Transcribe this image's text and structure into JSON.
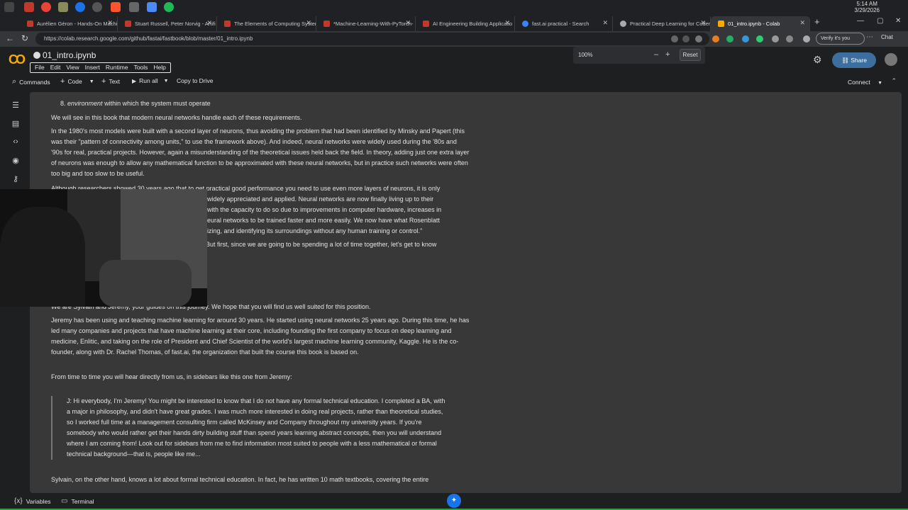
{
  "os": {
    "clock_time": "5:14 AM",
    "clock_date": "3/29/2026"
  },
  "tabs": [
    {
      "label": "Aurélien Géron - Hands-On Machi",
      "favicon_color": "#c0392b"
    },
    {
      "label": "Stuart Russell, Peter Norvig - Artifi",
      "favicon_color": "#c0392b"
    },
    {
      "label": "The Elements of Computing Syster",
      "favicon_color": "#c0392b"
    },
    {
      "label": "*Machine-Learning-With-PyTorch-",
      "favicon_color": "#c0392b"
    },
    {
      "label": "AI Engineering Building Applicatio",
      "favicon_color": "#c0392b"
    },
    {
      "label": "fast.ai practical - Search",
      "favicon_color": "#3b82f6"
    },
    {
      "label": "Practical Deep Learning for Coder:",
      "favicon_color": "#aaaaaa"
    },
    {
      "label": "01_intro.ipynb - Colab",
      "favicon_color": "#f9ab00",
      "active": true
    }
  ],
  "address_bar": {
    "url": "https://colab.research.google.com/github/fastai/fastbook/blob/master/01_intro.ipynb",
    "verify_label": "Verify it's you",
    "chat_label": "Chat"
  },
  "colab": {
    "logo": "CO",
    "notebook_title": "01_intro.ipynb",
    "menu": [
      "File",
      "Edit",
      "View",
      "Insert",
      "Runtime",
      "Tools",
      "Help"
    ],
    "zoom": {
      "level": "100%",
      "minus": "–",
      "plus": "+",
      "reset": "Reset"
    },
    "share_label": "Share",
    "toolbar": {
      "commands": "Commands",
      "code": "Code",
      "text": "Text",
      "run_all": "Run all",
      "copy_to_drive": "Copy to Drive",
      "connect": "Connect"
    }
  },
  "content": {
    "list_item_number": "8.",
    "list_item_em": "environment",
    "list_item_rest": "within which the system must operate",
    "p1": "We will see in this book that modern neural networks handle each of these requirements.",
    "p2": "In the 1980's most models were built with a second layer of neurons, thus avoiding the problem that had been identified by Minsky and Papert (this was their \"pattern of connectivity among units,\" to use the framework above). And indeed, neural networks were widely used during the '80s and '90s for real, practical projects. However, again a misunderstanding of the theoretical issues held back the field. In theory, adding just one extra layer of neurons was enough to allow any mathematical function to be approximated with these neural networks, but in practice such networks were often too big and too slow to be useful.",
    "p3_line1": "Although researchers showed 30 years ago that to get practical good performance you need to use even more layers of neurons, it is only",
    "p3_line2": "widely appreciated and applied. Neural networks are now finally living up to their",
    "p3_line3": "with the capacity to do so due to improvements in computer hardware, increases in",
    "p3_line4": "eural networks to be trained faster and more easily. We now have what Rosenblatt",
    "p3_line5": "izing, and identifying its surroundings without any human training or control.\"",
    "p4_fragment": "But first, since we are going to be spending a lot of time together, let's get to know",
    "p5": "We are Sylvain and Jeremy, your guides on this journey. We hope that you will find us well suited for this position.",
    "p6": "Jeremy has been using and teaching machine learning for around 30 years. He started using neural networks 25 years ago. During this time, he has led many companies and projects that have machine learning at their core, including founding the first company to focus on deep learning and medicine, Enlitic, and taking on the role of President and Chief Scientist of the world's largest machine learning community, Kaggle. He is the co-founder, along with Dr. Rachel Thomas, of fast.ai, the organization that built the course this book is based on.",
    "p7": "From time to time you will hear directly from us, in sidebars like this one from Jeremy:",
    "quote": "J: Hi everybody, I'm Jeremy! You might be interested to know that I do not have any formal technical education. I completed a BA, with a major in philosophy, and didn't have great grades. I was much more interested in doing real projects, rather than theoretical studies, so I worked full time at a management consulting firm called McKinsey and Company throughout my university years. If you're somebody who would rather get their hands dirty building stuff than spend years learning abstract concepts, then you will understand where I am coming from! Look out for sidebars from me to find information most suited to people with a less mathematical or formal technical background—that is, people like me...",
    "p8": "Sylvain, on the other hand, knows a lot about formal technical education. In fact, he has written 10 math textbooks, covering the entire"
  },
  "statusbar": {
    "variables": "Variables",
    "terminal": "Terminal"
  }
}
